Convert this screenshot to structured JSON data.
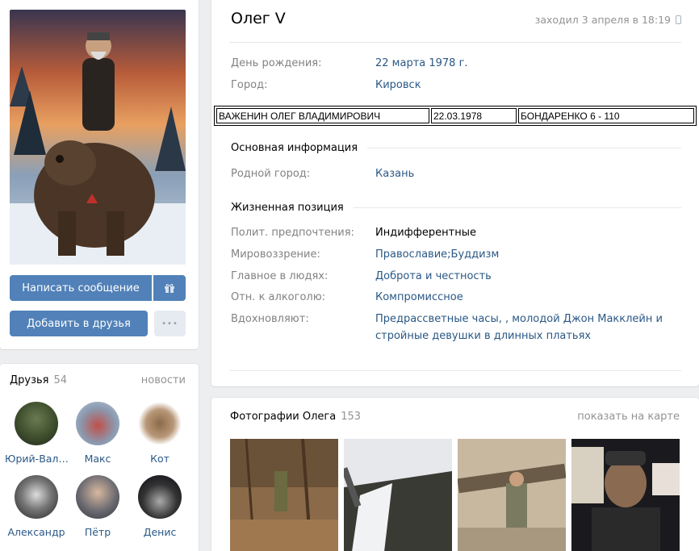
{
  "profile": {
    "name": "Олег V",
    "last_seen": "заходил 3 апреля в 18:19",
    "info": [
      {
        "label": "День рождения:",
        "value": "22 марта 1978 г."
      },
      {
        "label": "Город:",
        "value": "Кировск"
      }
    ],
    "dossier": [
      "ВАЖЕНИН ОЛЕГ ВЛАДИМИРОВИЧ",
      "22.03.1978",
      "БОНДАРЕНКО 6 - 110"
    ],
    "basic_header": "Основная информация",
    "basic": [
      {
        "label": "Родной город:",
        "value": "Казань"
      }
    ],
    "life_header": "Жизненная позиция",
    "life": [
      {
        "label": "Полит. предпочтения:",
        "value": "Индифферентные"
      },
      {
        "label": "Мировоззрение:",
        "value": "Православие;Буддизм"
      },
      {
        "label": "Главное в людях:",
        "value": "Доброта и честность"
      },
      {
        "label": "Отн. к алкоголю:",
        "value": "Компромиссное"
      },
      {
        "label": "Вдохновляют:",
        "value_line1": "Предрассветные часы, , молодой Джон Макклейн и",
        "value_line2": "стройные девушки в длинных платьях"
      }
    ]
  },
  "actions": {
    "message": "Написать сообщение",
    "add_friend": "Добавить в друзья",
    "more": "•••"
  },
  "friends": {
    "title": "Друзья",
    "count": "54",
    "news": "новости",
    "items": [
      {
        "name": "Юрий-Вал…"
      },
      {
        "name": "Макс"
      },
      {
        "name": "Кот"
      },
      {
        "name": "Александр"
      },
      {
        "name": "Пётр"
      },
      {
        "name": "Денис"
      }
    ]
  },
  "photos": {
    "title": "Фотографии Олега",
    "count": "153",
    "map_link": "показать на карте"
  },
  "colors": {
    "accent": "#5181b8",
    "link": "#2a5885",
    "muted": "#828282",
    "background": "#edeef0"
  }
}
